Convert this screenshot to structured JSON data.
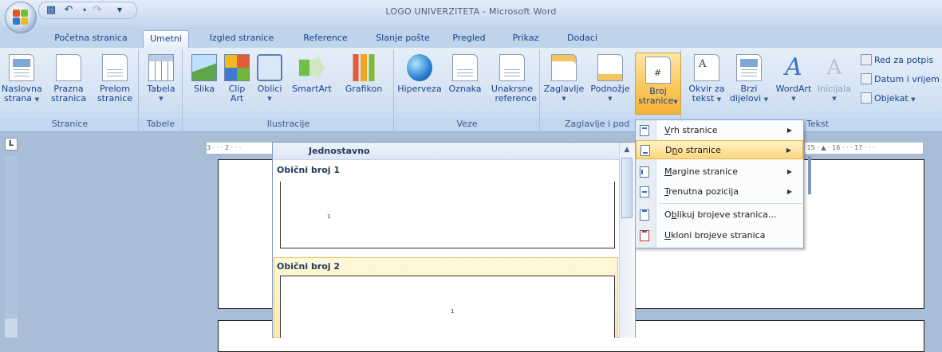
{
  "window": {
    "title": "LOGO UNIVERZITETA - Microsoft Word"
  },
  "quick_access": {
    "save_icon": "save-icon",
    "undo_icon": "undo-icon",
    "redo_icon": "redo-icon",
    "customize": "▼"
  },
  "tabs": [
    {
      "label": "Početna stranica",
      "active": false
    },
    {
      "label": "Umetni",
      "active": true
    },
    {
      "label": "Izgled stranice",
      "active": false
    },
    {
      "label": "Reference",
      "active": false
    },
    {
      "label": "Slanje pošte",
      "active": false
    },
    {
      "label": "Pregled",
      "active": false
    },
    {
      "label": "Prikaz",
      "active": false
    },
    {
      "label": "Dodaci",
      "active": false
    }
  ],
  "ribbon": {
    "groups": {
      "stranice": {
        "label": "Stranice",
        "naslovna_line1": "Naslovna",
        "naslovna_line2": "strana",
        "prazna_line1": "Prazna",
        "prazna_line2": "stranica",
        "prelom_line1": "Prelom",
        "prelom_line2": "stranice"
      },
      "tabele": {
        "label": "Tabele",
        "tabela": "Tabela"
      },
      "ilustracije": {
        "label": "Ilustracije",
        "slika": "Slika",
        "clipart_line1": "Clip",
        "clipart_line2": "Art",
        "oblici": "Oblici",
        "smartart": "SmartArt",
        "grafikon": "Grafikon"
      },
      "veze": {
        "label": "Veze",
        "hiperveza": "Hiperveza",
        "oznaka": "Oznaka",
        "unakrsne_line1": "Unakrsne",
        "unakrsne_line2": "reference"
      },
      "zaglavlje": {
        "label": "Zaglavlje i pod",
        "zaglavlje": "Zaglavlje",
        "podnozje": "Podnožje",
        "broj_line1": "Broj",
        "broj_line2": "stranice"
      },
      "tekst": {
        "label": "Tekst",
        "okvir_line1": "Okvir za",
        "okvir_line2": "tekst",
        "brzi_line1": "Brzi",
        "brzi_line2": "dijelovi",
        "wordart": "WordArt",
        "inicijala": "Inicijala",
        "red_za_potpis": "Red za potpis",
        "datum": "Datum i vrijem",
        "objekat": "Objekat"
      }
    }
  },
  "ruler": {
    "corner": "L",
    "left_marks": "3 · · · 2 · · ·",
    "right_marks": "·15 · ▲ · 16 · · · 17 · · ·"
  },
  "gallery": {
    "header": "Jednostavno",
    "items": [
      {
        "label": "Obični broj 1",
        "page_number": "1"
      },
      {
        "label": "Obični broj 2",
        "page_number": "1"
      }
    ]
  },
  "menu": {
    "items": [
      {
        "label_u": "V",
        "label_rest": "rh stranice",
        "submenu": "▶"
      },
      {
        "label_pre": "D",
        "label_u": "n",
        "label_rest": "o stranice",
        "submenu": "▶"
      },
      {
        "label_u": "M",
        "label_rest": "argine stranice",
        "submenu": "▶"
      },
      {
        "label_u": "T",
        "label_rest": "renutna pozicija",
        "submenu": "▶"
      },
      {
        "label_pre": "O",
        "label_u": "b",
        "label_rest": "likuj brojeve stranica..."
      },
      {
        "label_u": "U",
        "label_rest": "kloni brojeve stranica"
      }
    ]
  }
}
